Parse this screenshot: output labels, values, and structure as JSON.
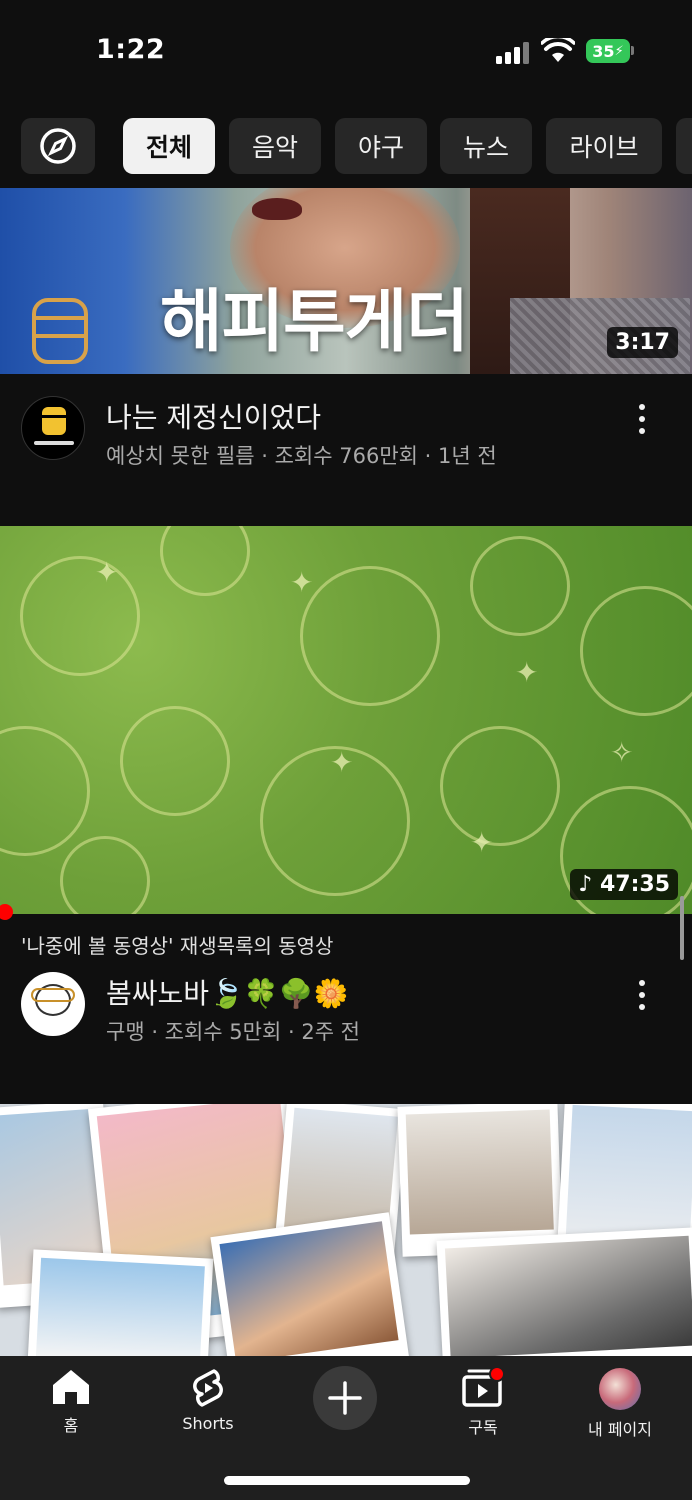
{
  "status_bar": {
    "time": "1:22",
    "battery": "35"
  },
  "chips": [
    "전체",
    "음악",
    "야구",
    "뉴스",
    "라이브"
  ],
  "videos": [
    {
      "thumbnail_text": "해피투게더",
      "duration": "3:17",
      "title": "나는 제정신이었다",
      "subtitle": "예상치 못한 필름 · 조회수 766만회 · 1년 전"
    },
    {
      "duration": "47:35",
      "playlist_note": "'나중에 볼 동영상' 재생목록의 동영상",
      "title": "봄싸노바🍃🍀🌳🌼",
      "subtitle": "구맹 · 조회수 5만회 · 2주 전"
    }
  ],
  "nav": {
    "home": "홈",
    "shorts": "Shorts",
    "subscriptions": "구독",
    "you": "내 페이지"
  },
  "colors": {
    "accent": "#ff0000",
    "battery": "#34c759",
    "background": "#0f0f0f"
  }
}
